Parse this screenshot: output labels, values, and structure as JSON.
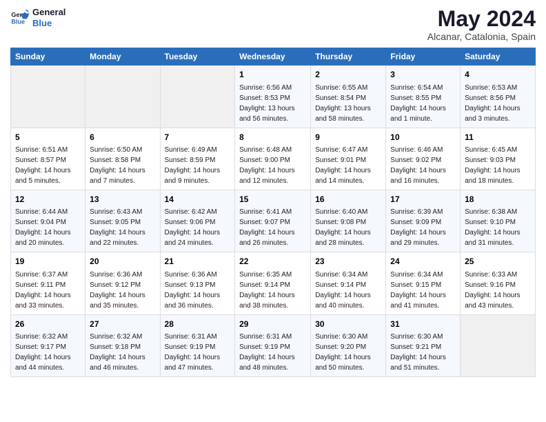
{
  "header": {
    "logo_line1": "General",
    "logo_line2": "Blue",
    "main_title": "May 2024",
    "subtitle": "Alcanar, Catalonia, Spain"
  },
  "days_of_week": [
    "Sunday",
    "Monday",
    "Tuesday",
    "Wednesday",
    "Thursday",
    "Friday",
    "Saturday"
  ],
  "weeks": [
    [
      {
        "day": "",
        "info": ""
      },
      {
        "day": "",
        "info": ""
      },
      {
        "day": "",
        "info": ""
      },
      {
        "day": "1",
        "info": "Sunrise: 6:56 AM\nSunset: 8:53 PM\nDaylight: 13 hours\nand 56 minutes."
      },
      {
        "day": "2",
        "info": "Sunrise: 6:55 AM\nSunset: 8:54 PM\nDaylight: 13 hours\nand 58 minutes."
      },
      {
        "day": "3",
        "info": "Sunrise: 6:54 AM\nSunset: 8:55 PM\nDaylight: 14 hours\nand 1 minute."
      },
      {
        "day": "4",
        "info": "Sunrise: 6:53 AM\nSunset: 8:56 PM\nDaylight: 14 hours\nand 3 minutes."
      }
    ],
    [
      {
        "day": "5",
        "info": "Sunrise: 6:51 AM\nSunset: 8:57 PM\nDaylight: 14 hours\nand 5 minutes."
      },
      {
        "day": "6",
        "info": "Sunrise: 6:50 AM\nSunset: 8:58 PM\nDaylight: 14 hours\nand 7 minutes."
      },
      {
        "day": "7",
        "info": "Sunrise: 6:49 AM\nSunset: 8:59 PM\nDaylight: 14 hours\nand 9 minutes."
      },
      {
        "day": "8",
        "info": "Sunrise: 6:48 AM\nSunset: 9:00 PM\nDaylight: 14 hours\nand 12 minutes."
      },
      {
        "day": "9",
        "info": "Sunrise: 6:47 AM\nSunset: 9:01 PM\nDaylight: 14 hours\nand 14 minutes."
      },
      {
        "day": "10",
        "info": "Sunrise: 6:46 AM\nSunset: 9:02 PM\nDaylight: 14 hours\nand 16 minutes."
      },
      {
        "day": "11",
        "info": "Sunrise: 6:45 AM\nSunset: 9:03 PM\nDaylight: 14 hours\nand 18 minutes."
      }
    ],
    [
      {
        "day": "12",
        "info": "Sunrise: 6:44 AM\nSunset: 9:04 PM\nDaylight: 14 hours\nand 20 minutes."
      },
      {
        "day": "13",
        "info": "Sunrise: 6:43 AM\nSunset: 9:05 PM\nDaylight: 14 hours\nand 22 minutes."
      },
      {
        "day": "14",
        "info": "Sunrise: 6:42 AM\nSunset: 9:06 PM\nDaylight: 14 hours\nand 24 minutes."
      },
      {
        "day": "15",
        "info": "Sunrise: 6:41 AM\nSunset: 9:07 PM\nDaylight: 14 hours\nand 26 minutes."
      },
      {
        "day": "16",
        "info": "Sunrise: 6:40 AM\nSunset: 9:08 PM\nDaylight: 14 hours\nand 28 minutes."
      },
      {
        "day": "17",
        "info": "Sunrise: 6:39 AM\nSunset: 9:09 PM\nDaylight: 14 hours\nand 29 minutes."
      },
      {
        "day": "18",
        "info": "Sunrise: 6:38 AM\nSunset: 9:10 PM\nDaylight: 14 hours\nand 31 minutes."
      }
    ],
    [
      {
        "day": "19",
        "info": "Sunrise: 6:37 AM\nSunset: 9:11 PM\nDaylight: 14 hours\nand 33 minutes."
      },
      {
        "day": "20",
        "info": "Sunrise: 6:36 AM\nSunset: 9:12 PM\nDaylight: 14 hours\nand 35 minutes."
      },
      {
        "day": "21",
        "info": "Sunrise: 6:36 AM\nSunset: 9:13 PM\nDaylight: 14 hours\nand 36 minutes."
      },
      {
        "day": "22",
        "info": "Sunrise: 6:35 AM\nSunset: 9:14 PM\nDaylight: 14 hours\nand 38 minutes."
      },
      {
        "day": "23",
        "info": "Sunrise: 6:34 AM\nSunset: 9:14 PM\nDaylight: 14 hours\nand 40 minutes."
      },
      {
        "day": "24",
        "info": "Sunrise: 6:34 AM\nSunset: 9:15 PM\nDaylight: 14 hours\nand 41 minutes."
      },
      {
        "day": "25",
        "info": "Sunrise: 6:33 AM\nSunset: 9:16 PM\nDaylight: 14 hours\nand 43 minutes."
      }
    ],
    [
      {
        "day": "26",
        "info": "Sunrise: 6:32 AM\nSunset: 9:17 PM\nDaylight: 14 hours\nand 44 minutes."
      },
      {
        "day": "27",
        "info": "Sunrise: 6:32 AM\nSunset: 9:18 PM\nDaylight: 14 hours\nand 46 minutes."
      },
      {
        "day": "28",
        "info": "Sunrise: 6:31 AM\nSunset: 9:19 PM\nDaylight: 14 hours\nand 47 minutes."
      },
      {
        "day": "29",
        "info": "Sunrise: 6:31 AM\nSunset: 9:19 PM\nDaylight: 14 hours\nand 48 minutes."
      },
      {
        "day": "30",
        "info": "Sunrise: 6:30 AM\nSunset: 9:20 PM\nDaylight: 14 hours\nand 50 minutes."
      },
      {
        "day": "31",
        "info": "Sunrise: 6:30 AM\nSunset: 9:21 PM\nDaylight: 14 hours\nand 51 minutes."
      },
      {
        "day": "",
        "info": ""
      }
    ]
  ]
}
